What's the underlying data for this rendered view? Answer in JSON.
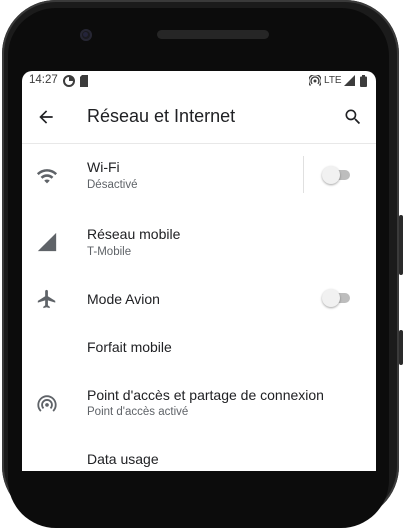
{
  "status_bar": {
    "time": "14:27",
    "network": "LTE"
  },
  "app_bar": {
    "title": "Réseau et Internet"
  },
  "settings": [
    {
      "key": "wifi",
      "label": "Wi-Fi",
      "sub": "Désactivé",
      "icon": "wifi-icon",
      "toggle": false
    },
    {
      "key": "mobile",
      "label": "Réseau mobile",
      "sub": "T-Mobile",
      "icon": "signal-icon"
    },
    {
      "key": "airplane",
      "label": "Mode Avion",
      "icon": "airplane-icon",
      "toggle": false
    },
    {
      "key": "plan",
      "label": "Forfait mobile"
    },
    {
      "key": "hotspot",
      "label": "Point d'accès et partage de connexion",
      "sub": "Point d'accès activé",
      "icon": "hotspot-icon"
    },
    {
      "key": "partial",
      "label": "Data usage"
    }
  ],
  "colors": {
    "text_primary": "#202124",
    "text_secondary": "#5f6368",
    "icon": "#5f6368",
    "toggle_off_track": "#bdbdbd",
    "toggle_off_thumb": "#f1f1f1"
  }
}
